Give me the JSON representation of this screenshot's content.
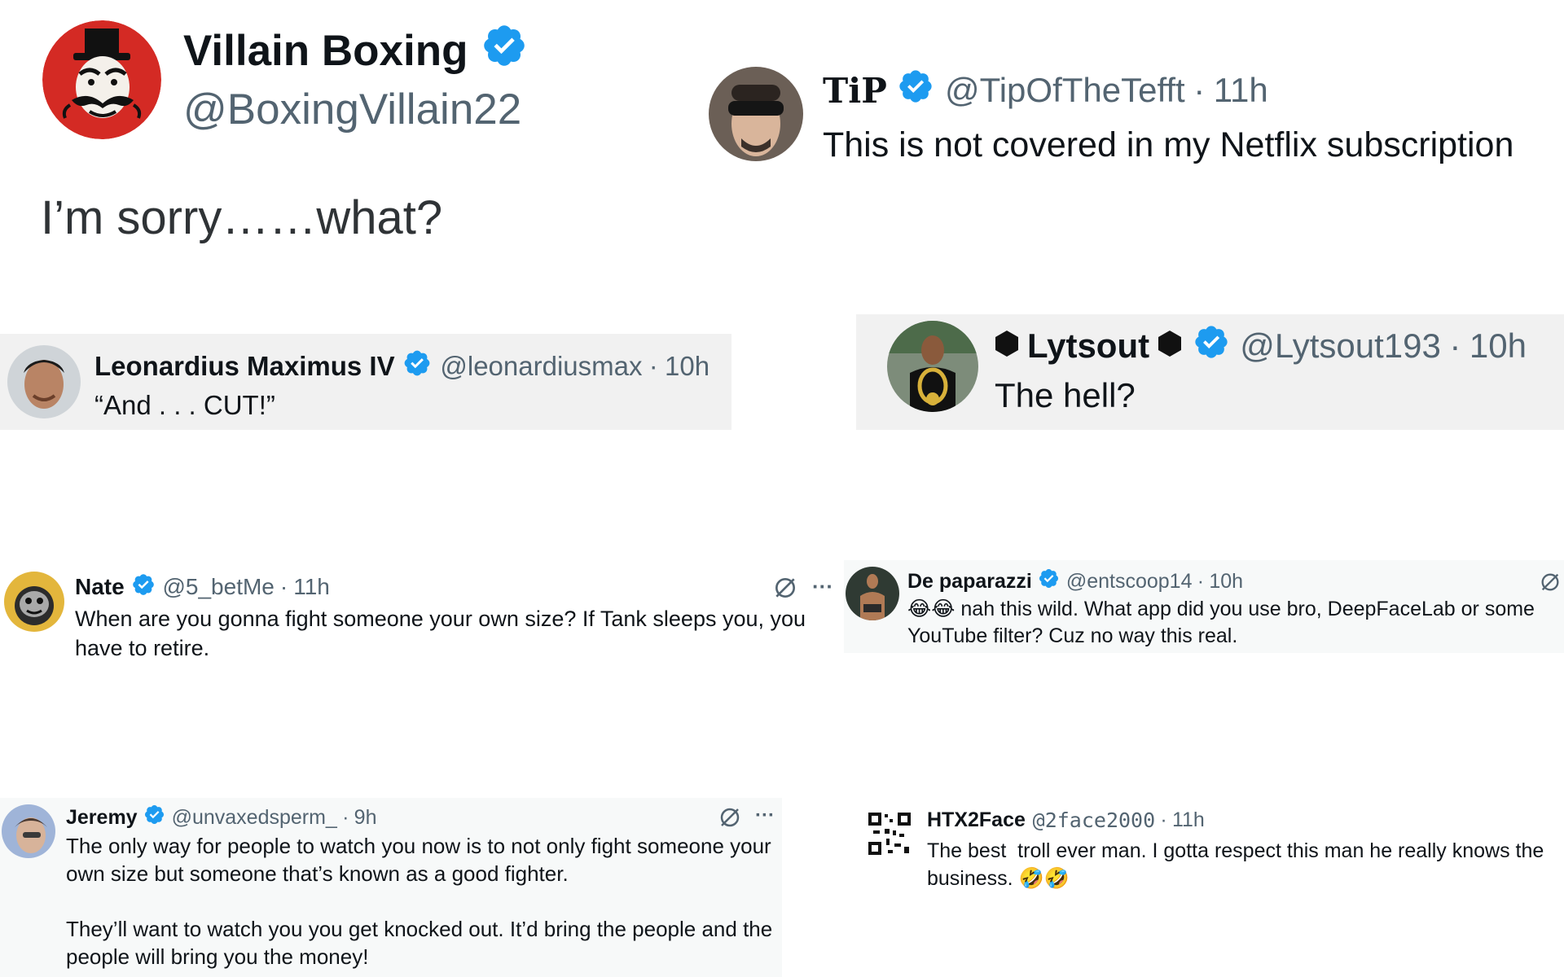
{
  "main_post": {
    "display_name": "Villain Boxing",
    "handle": "@BoxingVillain22",
    "text": "I’m sorry……what?"
  },
  "replies": [
    {
      "id": "tip",
      "display_name": "TiP",
      "handle": "@TipOfTheTefft",
      "time": "11h",
      "text": "This is not covered in my Netflix subscription"
    },
    {
      "id": "leonardius",
      "display_name": "Leonardius Maximus IV",
      "handle": "@leonardiusmax",
      "time": "10h",
      "text": "“And . . . CUT!”"
    },
    {
      "id": "lytsout",
      "display_name": "Lytsout",
      "handle": "@Lytsout193",
      "time": "10h",
      "text": "The hell?"
    },
    {
      "id": "nate",
      "display_name": "Nate",
      "handle": "@5_betMe",
      "time": "11h",
      "text_lines": [
        "When are you gonna fight someone your own size? If Tank sleeps you, you",
        "have to retire."
      ]
    },
    {
      "id": "depaparazzi",
      "display_name": "De paparazzi",
      "handle": "@entscoop14",
      "time": "10h",
      "emoji": "😂😂",
      "text_lines": [
        "nah this wild. What app did you use bro, DeepFaceLab or some",
        "YouTube filter? Cuz no way this real."
      ]
    },
    {
      "id": "jeremy",
      "display_name": "Jeremy",
      "handle": "@unvaxedsperm_",
      "time": "9h",
      "paragraph1": [
        "The only way for people to watch you now is to not only fight someone your",
        "own size but someone that’s known as a good fighter."
      ],
      "paragraph2": [
        "They’ll want to watch you you get knocked out. It’d bring the people and the",
        "people will bring you the money!"
      ]
    },
    {
      "id": "htx2face",
      "display_name": "HTX2Face",
      "handle": "@2face2000",
      "time": "11h",
      "text_lines": [
        "The best  troll ever man. I gotta respect this man he really knows the",
        "business."
      ],
      "emoji": "🤣🤣"
    }
  ],
  "separator": "·",
  "more_label": "···",
  "colors": {
    "verified_blue": "#1d9bf0",
    "text_primary": "#0f1419",
    "text_secondary": "#536471",
    "card_background": "#f1f1f1",
    "page_background": "#ffffff"
  },
  "icons": {
    "verified": "verified-badge-icon",
    "grok": "grok-icon",
    "more": "more-icon",
    "hexagon": "black-hexagon-icon"
  }
}
